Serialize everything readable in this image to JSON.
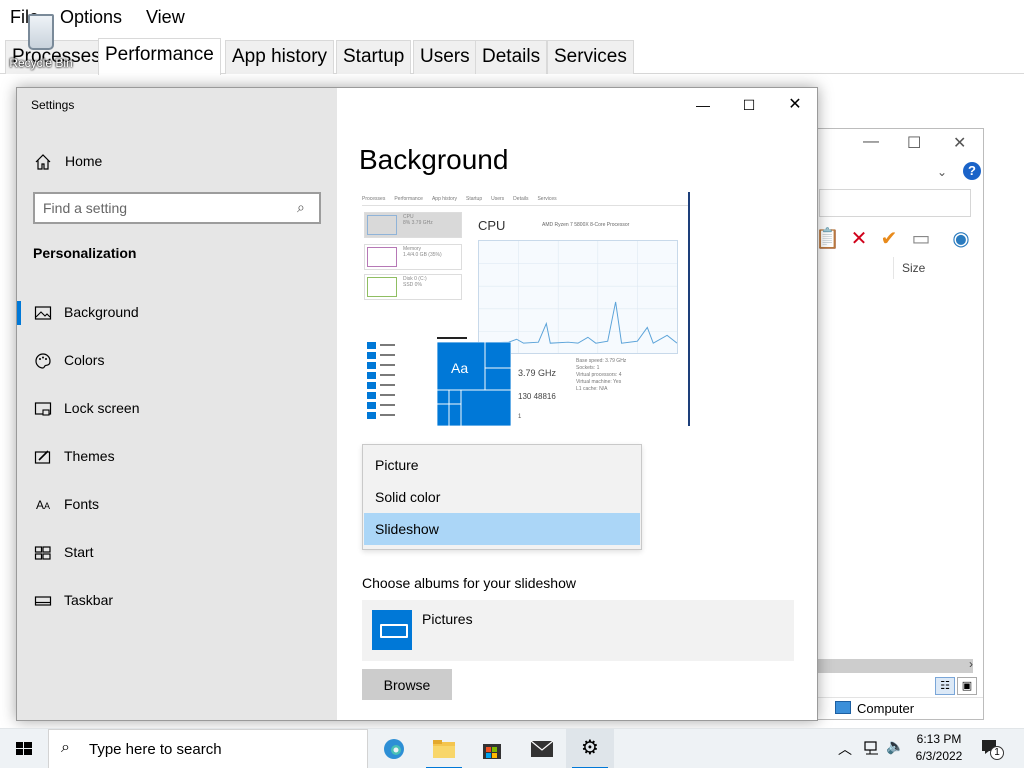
{
  "taskmanager": {
    "menu": [
      "File",
      "Options",
      "View"
    ],
    "tabs": [
      "Processes",
      "Performance",
      "App history",
      "Startup",
      "Users",
      "Details",
      "Services"
    ],
    "active_tab": "Performance"
  },
  "desktop": {
    "recycle_bin_label": "Recycle Bin"
  },
  "explorer": {
    "size_header": "Size",
    "status_location": "Computer"
  },
  "settings": {
    "window_title": "Settings",
    "home_label": "Home",
    "search_placeholder": "Find a setting",
    "section_title": "Personalization",
    "nav_items": [
      {
        "label": "Background",
        "icon": "image-icon",
        "selected": true
      },
      {
        "label": "Colors",
        "icon": "palette-icon",
        "selected": false
      },
      {
        "label": "Lock screen",
        "icon": "lock-screen-icon",
        "selected": false
      },
      {
        "label": "Themes",
        "icon": "themes-icon",
        "selected": false
      },
      {
        "label": "Fonts",
        "icon": "fonts-icon",
        "selected": false
      },
      {
        "label": "Start",
        "icon": "start-icon",
        "selected": false
      },
      {
        "label": "Taskbar",
        "icon": "taskbar-icon",
        "selected": false
      }
    ],
    "page_title": "Background",
    "preview": {
      "tabs": [
        "Processes",
        "Performance",
        "App history",
        "Startup",
        "Users",
        "Details",
        "Services"
      ],
      "tiles": [
        {
          "title": "CPU",
          "sub": "8% 3.79 GHz"
        },
        {
          "title": "Memory",
          "sub": "1.4/4.0 GB (35%)"
        },
        {
          "title": "Disk 0 (C:)",
          "sub": "SSD 0%"
        }
      ],
      "cpu_label": "CPU",
      "processor": "AMD Ryzen 7 5800X 8-Core Processor",
      "speed": "3.79 GHz",
      "counts": "130   48816",
      "stats": [
        "Base speed:   3.79 GHz",
        "Sockets:   1",
        "Virtual processors:   4",
        "Virtual machine:   Yes",
        "L1 cache:   N/A"
      ],
      "tile_text": "Aa",
      "one": "1"
    },
    "background_options": [
      "Picture",
      "Solid color",
      "Slideshow"
    ],
    "background_selected": "Slideshow",
    "albums_label": "Choose albums for your slideshow",
    "album_name": "Pictures",
    "browse_label": "Browse"
  },
  "taskbar": {
    "search_placeholder": "Type here to search",
    "time": "6:13 PM",
    "date": "6/3/2022",
    "notification_count": "1",
    "apps": [
      "edge-icon",
      "file-explorer-icon",
      "store-icon",
      "mail-icon",
      "settings-gear-icon"
    ]
  },
  "colors": {
    "accent": "#0078d7",
    "selected_option": "#abd6f7",
    "nav_background": "#e6e6e6"
  }
}
